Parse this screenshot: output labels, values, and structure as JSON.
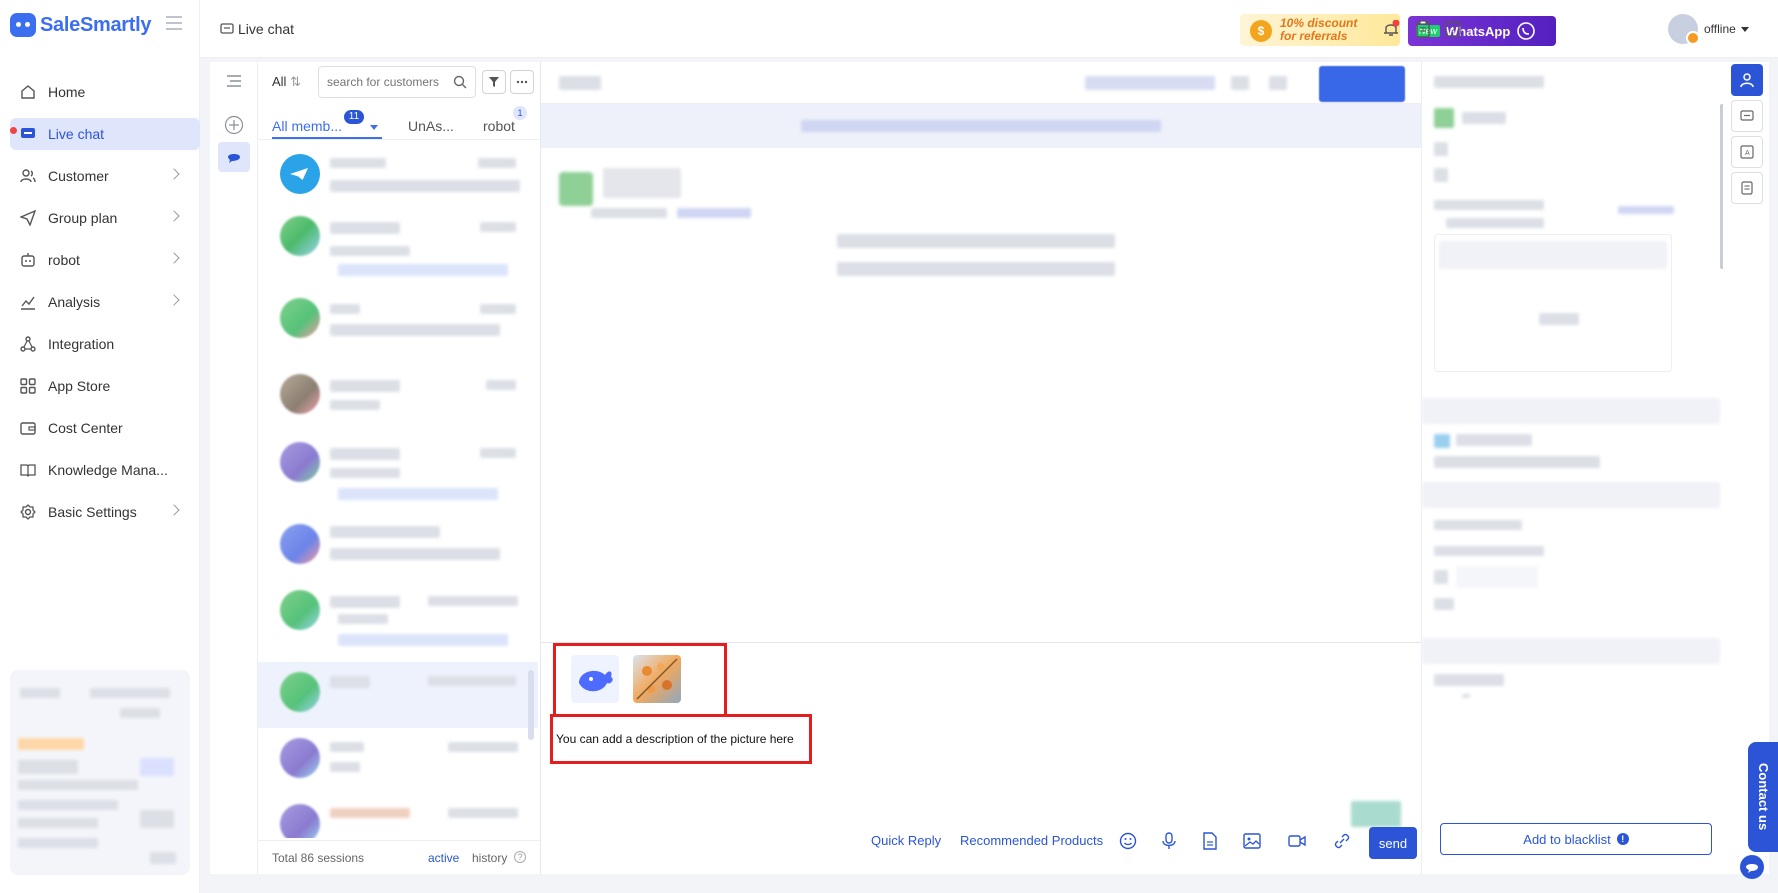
{
  "app": {
    "name": "SaleSmartly"
  },
  "nav": {
    "items": [
      {
        "label": "Home",
        "icon": "home-icon",
        "has_arrow": false
      },
      {
        "label": "Live chat",
        "icon": "live-chat-icon",
        "has_arrow": false,
        "active": true
      },
      {
        "label": "Customer",
        "icon": "customer-icon",
        "has_arrow": true
      },
      {
        "label": "Group plan",
        "icon": "send-icon",
        "has_arrow": true
      },
      {
        "label": "robot",
        "icon": "robot-icon",
        "has_arrow": true
      },
      {
        "label": "Analysis",
        "icon": "chart-icon",
        "has_arrow": true
      },
      {
        "label": "Integration",
        "icon": "integration-icon",
        "has_arrow": false
      },
      {
        "label": "App Store",
        "icon": "grid-icon",
        "has_arrow": false
      },
      {
        "label": "Cost Center",
        "icon": "wallet-icon",
        "has_arrow": false
      },
      {
        "label": "Knowledge Mana...",
        "icon": "book-icon",
        "has_arrow": false
      },
      {
        "label": "Basic Settings",
        "icon": "gear-icon",
        "has_arrow": true
      }
    ]
  },
  "header": {
    "breadcrumb": "Live chat",
    "promo_text": "10% discount for referrals",
    "promo_line1": "10% discount",
    "promo_line2": "for referrals",
    "whatsapp_new": "New",
    "whatsapp_label": "WhatsApp",
    "status": "offline"
  },
  "sessions": {
    "filter_all": "All",
    "search_placeholder": "search for customers",
    "tabs": [
      {
        "label": "All memb...",
        "badge": "11",
        "active": true
      },
      {
        "label": "UnAs...",
        "badge": ""
      },
      {
        "label": "robot",
        "badge": "1"
      }
    ],
    "total": "Total 86 sessions",
    "active_label": "active",
    "history_label": "history"
  },
  "composer": {
    "description": "You can add a description of the picture here",
    "quick_reply": "Quick Reply",
    "recommended_products": "Recommended Products",
    "send": "send"
  },
  "right_panel": {
    "blacklist": "Add to blacklist"
  },
  "floating": {
    "contact_us": "Contact us"
  },
  "colors": {
    "brand": "#3c6ff0",
    "primary": "#2b55d6",
    "highlight_box": "#e41e1e",
    "whatsapp_banner": "#7b34d6"
  }
}
